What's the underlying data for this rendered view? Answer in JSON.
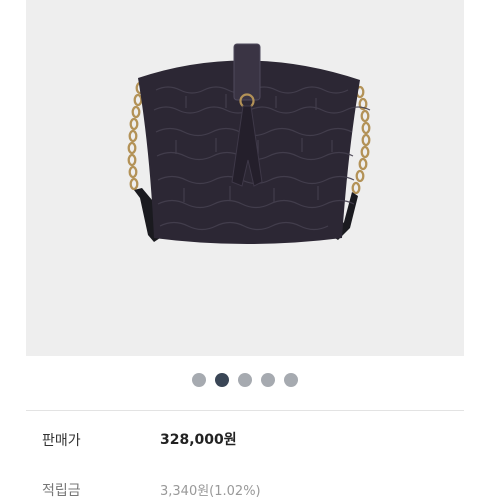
{
  "product": {
    "image_alt": "bag-photo",
    "bag_color": "#2c2734",
    "background_color": "#eeeeee"
  },
  "carousel": {
    "count": 5,
    "active_index": 1
  },
  "price": {
    "label": "판매가",
    "value": "328,000원"
  },
  "next_row": {
    "label": "적립금",
    "value": "3,340원(1.02%)"
  }
}
